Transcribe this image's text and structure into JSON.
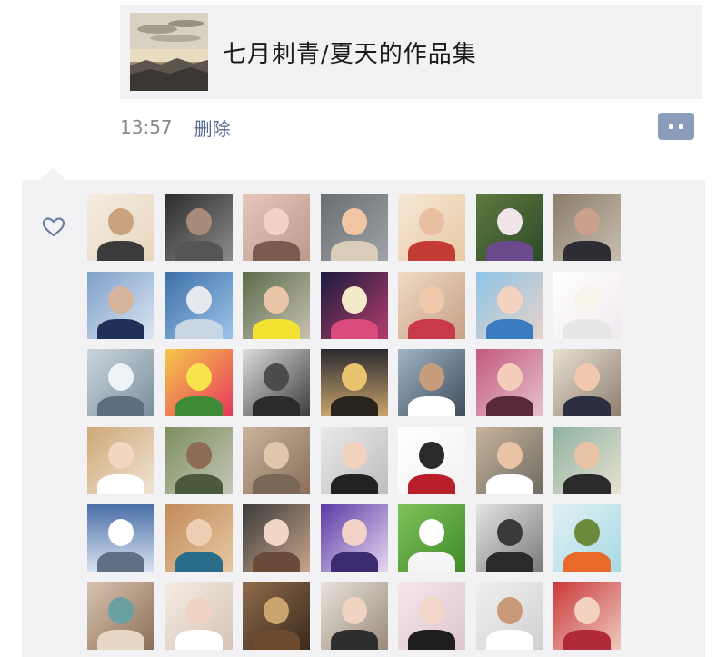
{
  "post": {
    "link_title": "七月刺青/夏天的作品集",
    "time": "13:57",
    "delete_label": "删除"
  },
  "likes": {
    "avatars": [
      {
        "bg": "linear-gradient(135deg,#f4ede1,#e9d5bd)",
        "head": "#c8a37d",
        "body": "#3b3b3b"
      },
      {
        "bg": "linear-gradient(135deg,#2c2c2c,#8c8c8c)",
        "head": "#a58b78",
        "body": "#555"
      },
      {
        "bg": "linear-gradient(135deg,#e8c6bc,#b99a8a)",
        "head": "#f1d2c4",
        "body": "#7a5b4e"
      },
      {
        "bg": "linear-gradient(135deg,#6a6d72,#9fa3a8)",
        "head": "#f0c5a4",
        "body": "#d9cdb9"
      },
      {
        "bg": "linear-gradient(135deg,#f6e8d5,#e8c9a4)",
        "head": "#e8bfa0",
        "body": "#c23b35"
      },
      {
        "bg": "linear-gradient(135deg,#5d7a3e,#2e4a2a)",
        "head": "#efe4e8",
        "body": "#6b4a8e"
      },
      {
        "bg": "linear-gradient(135deg,#8a7c6a,#c9bfb0)",
        "head": "#caa18a",
        "body": "#2d2d33"
      },
      {
        "bg": "linear-gradient(135deg,#7ea0c9,#dbe6f2)",
        "head": "#d7b49c",
        "body": "#1f2f55"
      },
      {
        "bg": "linear-gradient(135deg,#3d6fa8,#9cc4e8)",
        "head": "#e6e9ee",
        "body": "#c9d6e4"
      },
      {
        "bg": "linear-gradient(135deg,#5a6b4a,#c8c2b2)",
        "head": "#e9c6a8",
        "body": "#f2e232"
      },
      {
        "bg": "linear-gradient(135deg,#1a1c3f,#b43c6b)",
        "head": "#f4e9c9",
        "body": "#d84b7c"
      },
      {
        "bg": "linear-gradient(135deg,#efd9c4,#c7a184)",
        "head": "#f0c9ad",
        "body": "#c83a4a"
      },
      {
        "bg": "linear-gradient(135deg,#8fc3e8,#e7d4c8)",
        "head": "#f3d3c0",
        "body": "#3a7cc0"
      },
      {
        "bg": "linear-gradient(135deg,#ffffff,#f0e9ef)",
        "head": "#f8f4ea",
        "body": "#e7e7e7"
      },
      {
        "bg": "linear-gradient(135deg,#c9d5dd,#7b8e9c)",
        "head": "#eef3f5",
        "body": "#5b6f7e"
      },
      {
        "bg": "linear-gradient(135deg,#f5c84a,#e7385c)",
        "head": "#f7e34c",
        "body": "#3f8a36"
      },
      {
        "bg": "linear-gradient(135deg,#dcdcdc,#3c3c3c)",
        "head": "#4b4b4b",
        "body": "#2b2b2b"
      },
      {
        "bg": "linear-gradient(180deg,#2a2a2f,#c9a46d)",
        "head": "#e8c46e",
        "body": "#2a241e"
      },
      {
        "bg": "linear-gradient(135deg,#9fb5c7,#3f4c5a)",
        "head": "#c79c7a",
        "body": "#ffffff"
      },
      {
        "bg": "linear-gradient(135deg,#c25a7e,#e7c1cf)",
        "head": "#f3cdb9",
        "body": "#5a2a3a"
      },
      {
        "bg": "linear-gradient(135deg,#e9e0d2,#8e7e70)",
        "head": "#f0c9ad",
        "body": "#2e2e42"
      },
      {
        "bg": "linear-gradient(135deg,#cfa876,#efe4d4)",
        "head": "#f3d6c2",
        "body": "#ffffff"
      },
      {
        "bg": "linear-gradient(135deg,#7c8f5d,#c6c7b8)",
        "head": "#8e6b55",
        "body": "#4a5a3a"
      },
      {
        "bg": "linear-gradient(135deg,#c8b39b,#8a6f5a)",
        "head": "#e0c6ab",
        "body": "#7b6755"
      },
      {
        "bg": "linear-gradient(135deg,#e9e9e9,#bdbdbd)",
        "head": "#f0d2bf",
        "body": "#222222"
      },
      {
        "bg": "linear-gradient(135deg,#ffffff,#f2f2f2)",
        "head": "#2a2a2a",
        "body": "#b81f2b"
      },
      {
        "bg": "linear-gradient(135deg,#c7b49b,#6f6a62)",
        "head": "#e9c3a5",
        "body": "#ffffff"
      },
      {
        "bg": "linear-gradient(135deg,#8fb2a0,#e8e2d2)",
        "head": "#e8c3a6",
        "body": "#2a2a2a"
      },
      {
        "bg": "linear-gradient(180deg,#4a6ea6,#d9e3f0)",
        "head": "#ffffff",
        "body": "#5f6f86"
      },
      {
        "bg": "linear-gradient(135deg,#c08a5a,#e7c9a1)",
        "head": "#efcfb3",
        "body": "#2a6b8a"
      },
      {
        "bg": "linear-gradient(135deg,#3b3b3b,#c9a58a)",
        "head": "#f1d6c6",
        "body": "#6a4a3a"
      },
      {
        "bg": "linear-gradient(135deg,#5a3aa8,#e7d8ee)",
        "head": "#f3d3c8",
        "body": "#3b2b6e"
      },
      {
        "bg": "linear-gradient(135deg,#7fc25a,#3e8a2a)",
        "head": "#ffffff",
        "body": "#f5f5f5"
      },
      {
        "bg": "linear-gradient(135deg,#e5e5e5,#7a7a7a)",
        "head": "#3a3a3a",
        "body": "#2a2a2a"
      },
      {
        "bg": "linear-gradient(135deg,#dff1f5,#a8d9e2)",
        "head": "#6b8a3a",
        "body": "#e8692a"
      },
      {
        "bg": "linear-gradient(135deg,#d8c3ae,#8a6e58)",
        "head": "#6aa0a0",
        "body": "#e8d7c4"
      },
      {
        "bg": "linear-gradient(135deg,#f4ece3,#d6c3b4)",
        "head": "#f0d3c2",
        "body": "#ffffff"
      },
      {
        "bg": "linear-gradient(135deg,#8e6b4a,#3b2a1e)",
        "head": "#c8a46e",
        "body": "#6e4a2e"
      },
      {
        "bg": "linear-gradient(135deg,#e8e2da,#9a8a7a)",
        "head": "#f0d3c0",
        "body": "#2e2e2e"
      },
      {
        "bg": "linear-gradient(135deg,#f6e6ea,#dcc6cc)",
        "head": "#f3d6ca",
        "body": "#1e1e1e"
      },
      {
        "bg": "linear-gradient(135deg,#f0f0f0,#d0d0d0)",
        "head": "#c89a7a",
        "body": "#ffffff"
      },
      {
        "bg": "linear-gradient(135deg,#c93a3a,#f0c9c0)",
        "head": "#f3d1c1",
        "body": "#b02a3a"
      }
    ]
  }
}
